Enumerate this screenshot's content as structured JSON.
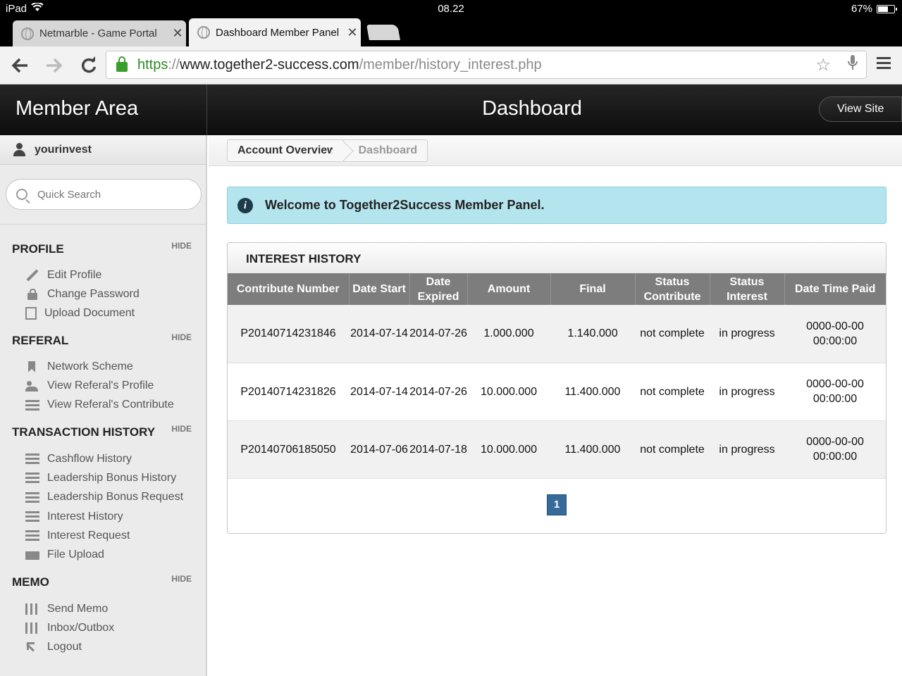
{
  "status_bar": {
    "device": "iPad",
    "time": "08.22",
    "battery": "67%",
    "battery_level": 0.67
  },
  "browser": {
    "tabs": [
      {
        "title": "Netmarble - Game Portal",
        "active": false
      },
      {
        "title": "Dashboard Member Panel",
        "active": true
      }
    ],
    "url": {
      "scheme": "https",
      "sep": "://",
      "host": "www.together2-success.com",
      "path": "/member/history_interest.php"
    }
  },
  "header": {
    "brand": "Member Area",
    "page_title": "Dashboard",
    "view_site": "View Site"
  },
  "sidebar": {
    "username": "yourinvest",
    "search_placeholder": "Quick Search",
    "hide_label": "HIDE",
    "sections": [
      {
        "title": "PROFILE",
        "items": [
          {
            "label": "Edit Profile",
            "icon": "pencil-icon"
          },
          {
            "label": "Change Password",
            "icon": "lock-icon"
          },
          {
            "label": "Upload Document",
            "icon": "upload-icon"
          }
        ]
      },
      {
        "title": "REFERAL",
        "items": [
          {
            "label": "Network Scheme",
            "icon": "bookmark-icon"
          },
          {
            "label": "View Referal's Profile",
            "icon": "people-icon"
          },
          {
            "label": "View Referal's Contribute",
            "icon": "list-icon"
          }
        ]
      },
      {
        "title": "TRANSACTION HISTORY",
        "items": [
          {
            "label": "Cashflow History",
            "icon": "list-icon"
          },
          {
            "label": "Leadership Bonus History",
            "icon": "list-icon"
          },
          {
            "label": "Leadership Bonus Request",
            "icon": "list-icon"
          },
          {
            "label": "Interest History",
            "icon": "list-icon"
          },
          {
            "label": "Interest Request",
            "icon": "list-icon"
          },
          {
            "label": "File Upload",
            "icon": "folder-icon"
          }
        ]
      },
      {
        "title": "MEMO",
        "items": [
          {
            "label": "Send Memo",
            "icon": "sliders-icon"
          },
          {
            "label": "Inbox/Outbox",
            "icon": "sliders-icon"
          },
          {
            "label": "Logout",
            "icon": "logout-icon"
          }
        ]
      }
    ]
  },
  "breadcrumb": [
    "Account Overview",
    "Dashboard"
  ],
  "alert": "Welcome to Together2Success Member Panel.",
  "interest_history": {
    "title": "INTEREST HISTORY",
    "columns": [
      "Contribute Number",
      "Date Start",
      "Date Expired",
      "Amount",
      "Final",
      "Status Contribute",
      "Status Interest",
      "Date Time Paid"
    ],
    "rows": [
      [
        "P20140714231846",
        "2014-07-14",
        "2014-07-26",
        "1.000.000",
        "1.140.000",
        "not complete",
        "in progress",
        "0000-00-00 00:00:00"
      ],
      [
        "P20140714231826",
        "2014-07-14",
        "2014-07-26",
        "10.000.000",
        "11.400.000",
        "not complete",
        "in progress",
        "0000-00-00 00:00:00"
      ],
      [
        "P20140706185050",
        "2014-07-06",
        "2014-07-18",
        "10.000.000",
        "11.400.000",
        "not complete",
        "in progress",
        "0000-00-00 00:00:00"
      ]
    ],
    "page": "1"
  },
  "colors": {
    "header_bg": "#111111",
    "alert_bg": "#b4e5ee",
    "table_header": "#7d7d7d",
    "pager": "#356a99",
    "secure_green": "#2d8a22"
  }
}
